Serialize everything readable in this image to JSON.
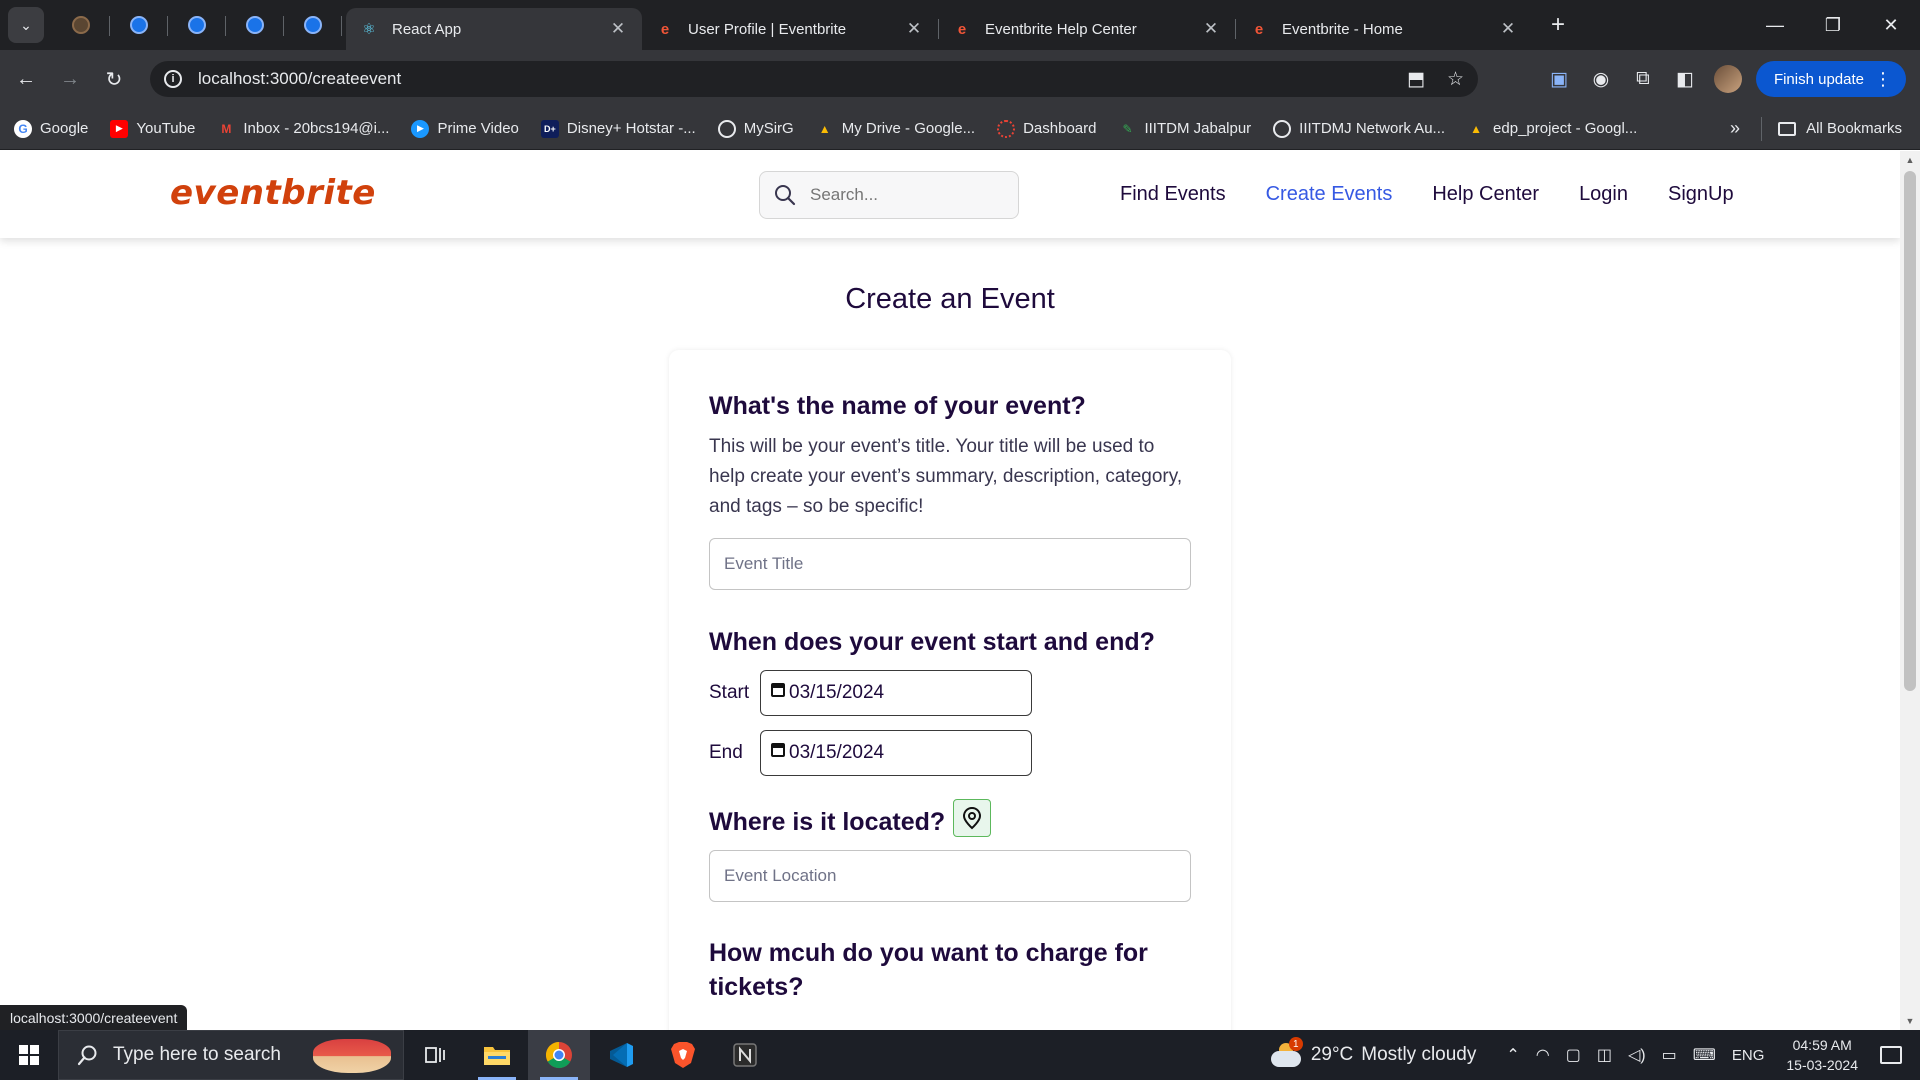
{
  "browser": {
    "tabs": [
      {
        "title": "React App",
        "icon": "react-icon",
        "active": true
      },
      {
        "title": "User Profile | Eventbrite",
        "icon": "eventbrite-icon",
        "active": false
      },
      {
        "title": "Eventbrite Help Center",
        "icon": "eventbrite-icon",
        "active": false
      },
      {
        "title": "Eventbrite - Home",
        "icon": "eventbrite-icon",
        "active": false
      }
    ],
    "url": "localhost:3000/createevent",
    "finish_update_label": "Finish update",
    "bookmarks": [
      {
        "label": "Google",
        "icon": "google-icon"
      },
      {
        "label": "YouTube",
        "icon": "youtube-icon"
      },
      {
        "label": "Inbox - 20bcs194@i...",
        "icon": "gmail-icon"
      },
      {
        "label": "Prime Video",
        "icon": "prime-video-icon"
      },
      {
        "label": "Disney+ Hotstar -...",
        "icon": "hotstar-icon"
      },
      {
        "label": "MySirG",
        "icon": "globe-icon"
      },
      {
        "label": "My Drive - Google...",
        "icon": "drive-icon"
      },
      {
        "label": "Dashboard",
        "icon": "dashboard-icon"
      },
      {
        "label": "IIITDM Jabalpur",
        "icon": "iiitdm-icon"
      },
      {
        "label": "IIITDMJ Network Au...",
        "icon": "globe-icon"
      },
      {
        "label": "edp_project - Googl...",
        "icon": "drive-icon"
      }
    ],
    "all_bookmarks_label": "All Bookmarks",
    "status_url": "localhost:3000/createevent"
  },
  "site": {
    "logo": "eventbrite",
    "search_placeholder": "Search...",
    "nav": [
      {
        "label": "Find Events",
        "active": false
      },
      {
        "label": "Create Events",
        "active": true
      },
      {
        "label": "Help Center",
        "active": false
      },
      {
        "label": "Login",
        "active": false
      },
      {
        "label": "SignUp",
        "active": false
      }
    ],
    "accent_color": "#d1410c",
    "active_link_color": "#3659e3"
  },
  "form": {
    "page_title": "Create an Event",
    "name_question": "What's the name of your event?",
    "name_description": "This will be your event’s title. Your title will be used to help create your event’s summary, description, category, and tags – so be specific!",
    "title_placeholder": "Event Title",
    "date_question": "When does your event start and end?",
    "start_label": "Start",
    "start_value": "03/15/2024",
    "end_label": "End",
    "end_value": "03/15/2024",
    "location_question": "Where is it located?",
    "location_placeholder": "Event Location",
    "price_question": "How mcuh do you want to charge for tickets?"
  },
  "taskbar": {
    "search_placeholder": "Type here to search",
    "weather_temp": "29°C",
    "weather_desc": "Mostly cloudy",
    "weather_badge": "1",
    "language": "ENG",
    "time": "04:59 AM",
    "date": "15-03-2024"
  }
}
